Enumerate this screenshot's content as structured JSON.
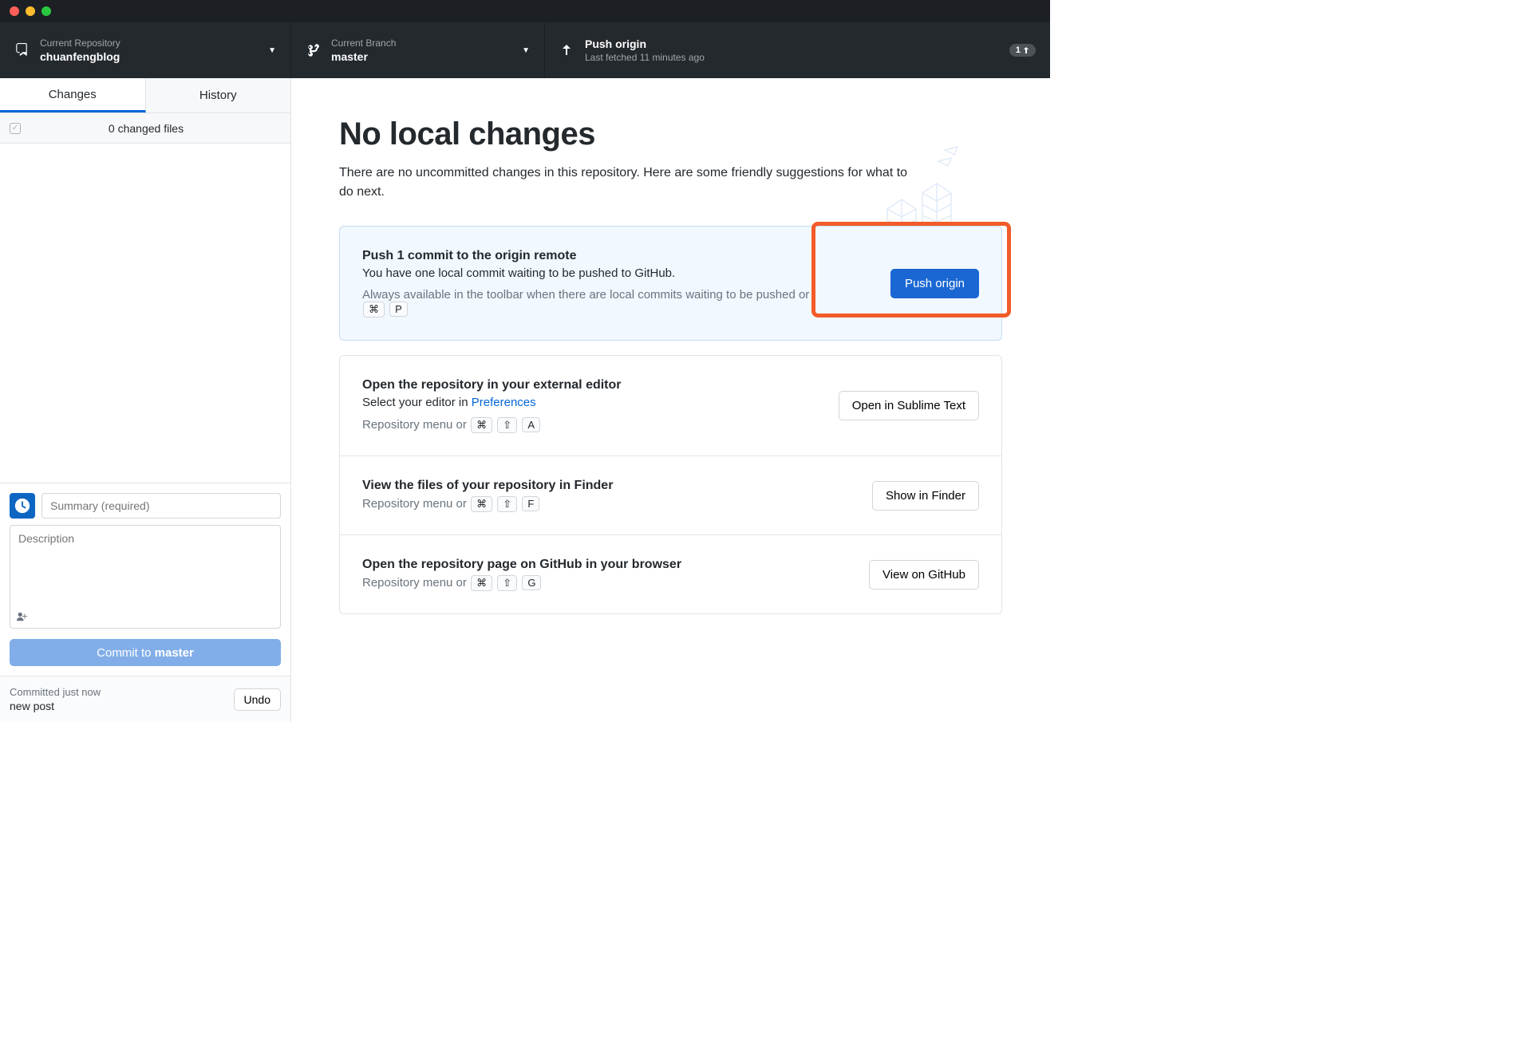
{
  "toolbar": {
    "repo": {
      "label": "Current Repository",
      "value": "chuanfengblog"
    },
    "branch": {
      "label": "Current Branch",
      "value": "master"
    },
    "push": {
      "label": "Push origin",
      "sub": "Last fetched 11 minutes ago",
      "badge_count": "1"
    }
  },
  "tabs": {
    "changes": "Changes",
    "history": "History"
  },
  "changes_header": "0 changed files",
  "commit_form": {
    "summary_placeholder": "Summary (required)",
    "desc_placeholder": "Description",
    "button_prefix": "Commit to ",
    "button_branch": "master"
  },
  "undo": {
    "time": "Committed just now",
    "message": "new post",
    "button": "Undo"
  },
  "main": {
    "title": "No local changes",
    "subtitle": "There are no uncommitted changes in this repository. Here are some friendly suggestions for what to do next."
  },
  "cards": {
    "push": {
      "title": "Push 1 commit to the origin remote",
      "desc": "You have one local commit waiting to be pushed to GitHub.",
      "hint": "Always available in the toolbar when there are local commits waiting to be pushed or",
      "keys": [
        "⌘",
        "P"
      ],
      "button": "Push origin"
    },
    "editor": {
      "title": "Open the repository in your external editor",
      "desc_prefix": "Select your editor in ",
      "desc_link": "Preferences",
      "hint": "Repository menu or",
      "keys": [
        "⌘",
        "⇧",
        "A"
      ],
      "button": "Open in Sublime Text"
    },
    "finder": {
      "title": "View the files of your repository in Finder",
      "hint": "Repository menu or",
      "keys": [
        "⌘",
        "⇧",
        "F"
      ],
      "button": "Show in Finder"
    },
    "github": {
      "title": "Open the repository page on GitHub in your browser",
      "hint": "Repository menu or",
      "keys": [
        "⌘",
        "⇧",
        "G"
      ],
      "button": "View on GitHub"
    }
  }
}
